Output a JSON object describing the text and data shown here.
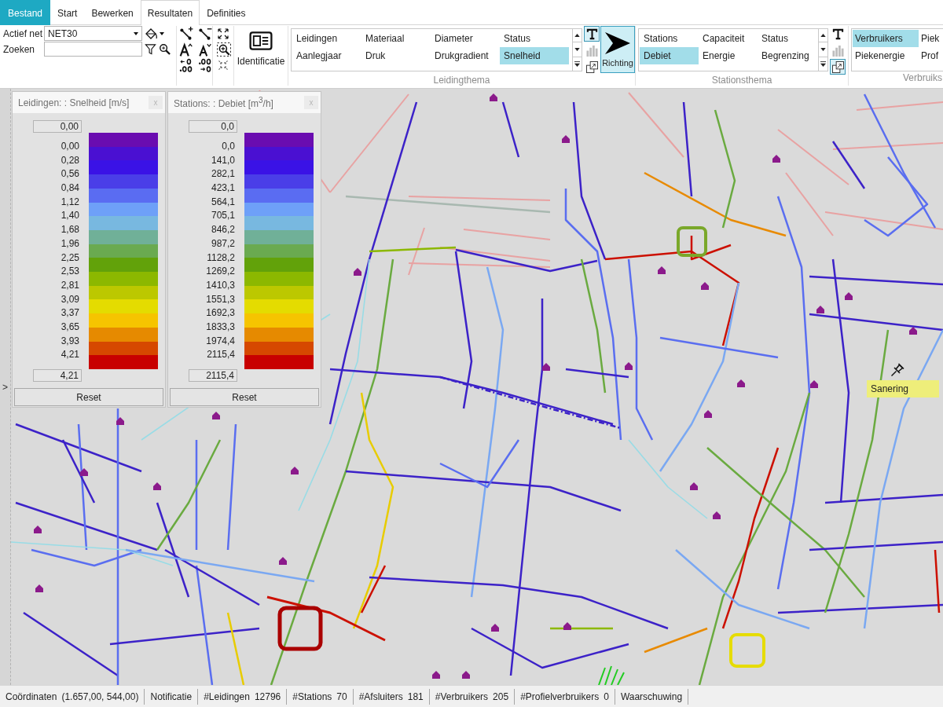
{
  "ribbon": {
    "tabs": [
      {
        "label": "Bestand",
        "kind": "file",
        "selected": false
      },
      {
        "label": "Start",
        "kind": "tab",
        "selected": false
      },
      {
        "label": "Bewerken",
        "kind": "tab",
        "selected": false
      },
      {
        "label": "Resultaten",
        "kind": "tab",
        "selected": true
      },
      {
        "label": "Definities",
        "kind": "tab",
        "selected": false
      }
    ]
  },
  "network_group": {
    "active_net_label": "Actief net",
    "active_net": "NET30",
    "search_label": "Zoeken"
  },
  "identify_button": {
    "label": "Identificatie"
  },
  "pipe_theme": {
    "label": "Leidingthema",
    "items": [
      {
        "label": "Leidingen",
        "selected": false
      },
      {
        "label": "Materiaal",
        "selected": false
      },
      {
        "label": "Diameter",
        "selected": false
      },
      {
        "label": "Status",
        "selected": false
      },
      {
        "label": "Aanlegjaar",
        "selected": false
      },
      {
        "label": "Druk",
        "selected": false
      },
      {
        "label": "Drukgradient",
        "selected": false
      },
      {
        "label": "Snelheid",
        "selected": true
      }
    ],
    "toggles": [
      {
        "kind": "labels",
        "on": true,
        "disabled": false
      },
      {
        "kind": "chart",
        "on": false,
        "disabled": true
      },
      {
        "kind": "overlay",
        "on": false,
        "disabled": false
      }
    ]
  },
  "direction_button": {
    "label": "Richting",
    "selected": true
  },
  "station_theme": {
    "label": "Stationsthema",
    "items": [
      {
        "label": "Stations",
        "selected": false
      },
      {
        "label": "Capaciteit",
        "selected": false
      },
      {
        "label": "Status",
        "selected": false
      },
      {
        "label": "Debiet",
        "selected": true
      },
      {
        "label": "Energie",
        "selected": false
      },
      {
        "label": "Begrenzing",
        "selected": false
      }
    ],
    "toggles": [
      {
        "kind": "labels",
        "on": false,
        "disabled": false
      },
      {
        "kind": "chart",
        "on": false,
        "disabled": true
      },
      {
        "kind": "overlay",
        "on": true,
        "disabled": false
      }
    ]
  },
  "consumer_theme": {
    "label": "Verbruiks",
    "items": [
      {
        "label": "Verbruikers",
        "selected": true
      },
      {
        "label": "Piek",
        "selected": false
      },
      {
        "label": "Piekenergie",
        "selected": false
      },
      {
        "label": "Prof",
        "selected": false
      }
    ]
  },
  "side_panel_toggle": ">",
  "legends": [
    {
      "title": "Leidingen: : Snelheid [m/s]",
      "close": "x",
      "min": "0,00",
      "max": "4,21",
      "labels": [
        "0,00",
        "0,28",
        "0,56",
        "0,84",
        "1,12",
        "1,40",
        "1,68",
        "1,96",
        "2,25",
        "2,53",
        "2,81",
        "3,09",
        "3,37",
        "3,65",
        "3,93",
        "4,21"
      ],
      "bands": [
        {
          "color": "#6a0cb0"
        },
        {
          "color": "#4a10d2"
        },
        {
          "color": "#3a12e6"
        },
        {
          "color": "#4a3ee8"
        },
        {
          "color": "#5a6cf2"
        },
        {
          "color": "#6ea0f8"
        },
        {
          "color": "#78b8e0"
        },
        {
          "color": "#70b098"
        },
        {
          "color": "#6aaa50"
        },
        {
          "color": "#62a20a"
        },
        {
          "color": "#8cb800"
        },
        {
          "color": "#bcc800"
        },
        {
          "color": "#e4dc00"
        },
        {
          "color": "#f6c400"
        },
        {
          "color": "#e68a00"
        },
        {
          "color": "#d64800"
        },
        {
          "color": "#c80000"
        }
      ],
      "reset": "Reset"
    },
    {
      "title": "Stations: : Debiet [m$^{3}$/h]",
      "close": "x",
      "min": "0,0",
      "max": "2115,4",
      "labels": [
        "0,0",
        "141,0",
        "282,1",
        "423,1",
        "564,1",
        "705,1",
        "846,2",
        "987,2",
        "1128,2",
        "1269,2",
        "1410,3",
        "1551,3",
        "1692,3",
        "1833,3",
        "1974,4",
        "2115,4"
      ],
      "bands": [
        {
          "color": "#6a0cb0"
        },
        {
          "color": "#4a10d2"
        },
        {
          "color": "#3a12e6"
        },
        {
          "color": "#4a3ee8"
        },
        {
          "color": "#5a6cf2"
        },
        {
          "color": "#6ea0f8"
        },
        {
          "color": "#78b8e0"
        },
        {
          "color": "#70b098"
        },
        {
          "color": "#6aaa50"
        },
        {
          "color": "#62a20a"
        },
        {
          "color": "#8cb800"
        },
        {
          "color": "#bcc800"
        },
        {
          "color": "#e4dc00"
        },
        {
          "color": "#f6c400"
        },
        {
          "color": "#e68a00"
        },
        {
          "color": "#d64800"
        },
        {
          "color": "#c80000"
        }
      ],
      "reset": "Reset"
    }
  ],
  "map": {
    "annotations": [
      {
        "label": "Sanering"
      }
    ]
  },
  "status_bar": [
    {
      "label": "Coördinaten",
      "value": "(1.657,00, 544,00)"
    },
    {
      "label": "Notificatie"
    },
    {
      "label": "#Leidingen",
      "value": "12796"
    },
    {
      "label": "#Stations",
      "value": "70"
    },
    {
      "label": "#Afsluiters",
      "value": "181"
    },
    {
      "label": "#Verbruikers",
      "value": "205"
    },
    {
      "label": "#Profielverbruikers",
      "value": "0"
    },
    {
      "label": "Waarschuwing"
    }
  ]
}
